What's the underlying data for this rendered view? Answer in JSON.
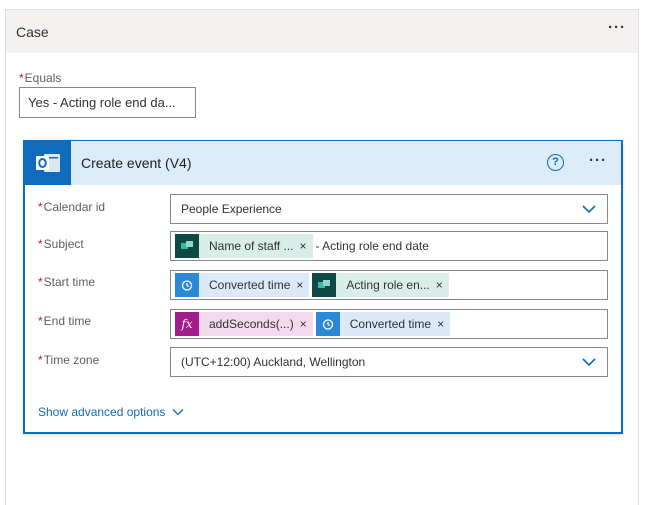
{
  "case": {
    "title": "Case",
    "menu": "···"
  },
  "equals": {
    "required_mark": "*",
    "label": "Equals",
    "value": "Yes - Acting role end da..."
  },
  "action": {
    "title": "Create event (V4)",
    "help": "?",
    "menu": "···",
    "fields": {
      "calendar": {
        "required_mark": "*",
        "label": "Calendar id",
        "value": "People Experience"
      },
      "subject": {
        "required_mark": "*",
        "label": "Subject",
        "token_label": "Name of staff ...",
        "suffix": "- Acting role end date"
      },
      "start": {
        "required_mark": "*",
        "label": "Start time",
        "token1_label": "Converted time",
        "token2_label": "Acting role en..."
      },
      "end": {
        "required_mark": "*",
        "label": "End time",
        "token1_label": "addSeconds(...)",
        "token2_label": "Converted time",
        "fx": "fx"
      },
      "timezone": {
        "required_mark": "*",
        "label": "Time zone",
        "value": "(UTC+12:00) Auckland, Wellington"
      }
    },
    "advanced": "Show advanced options",
    "remove": "×"
  },
  "colors": {
    "accent": "#0f6cbd",
    "header_bg": "#dcecf9",
    "required": "#a4262c"
  }
}
